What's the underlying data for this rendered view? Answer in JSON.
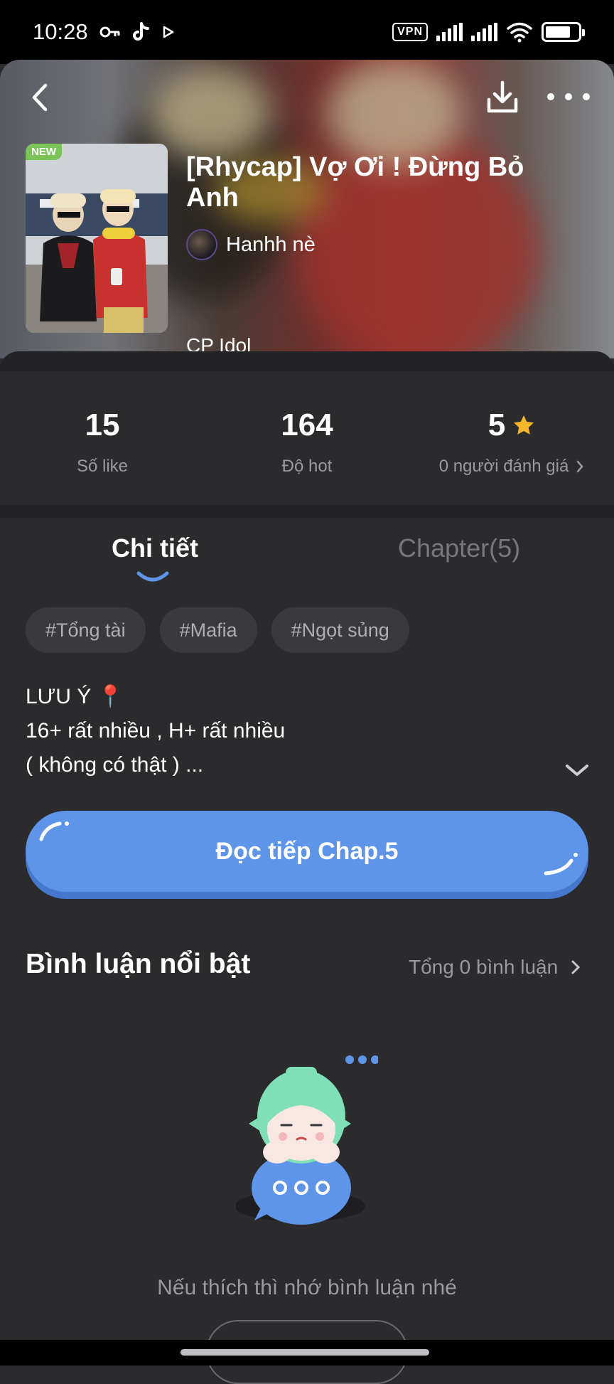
{
  "status_bar": {
    "time": "10:28",
    "vpn_label": "VPN",
    "battery_level": 0.78,
    "icons": [
      "key-icon",
      "tiktok-icon",
      "play-icon",
      "vpn-icon",
      "signal-icon",
      "signal-icon",
      "wifi-icon",
      "battery-icon"
    ]
  },
  "header": {
    "icons": [
      "back-arrow-icon",
      "download-icon",
      "more-icon"
    ]
  },
  "story": {
    "badge": "NEW",
    "title": "[Rhycap] Vợ Ơi ! Đừng Bỏ Anh",
    "author": "Hanhh nè",
    "category": "CP Idol"
  },
  "stats": {
    "likes_value": "15",
    "likes_label": "Số like",
    "hot_value": "164",
    "hot_label": "Độ hot",
    "rating_value": "5",
    "rating_label": "0 người đánh giá",
    "star_color": "#f5b62a"
  },
  "tabs": {
    "details": "Chi tiết",
    "chapters": "Chapter(5)",
    "active": "details"
  },
  "tags": [
    "#Tổng tài",
    "#Mafia",
    "#Ngọt sủng"
  ],
  "description": {
    "line1": "LƯU Ý 📍",
    "line2": "16+ rất nhiều , H+ rất nhiều",
    "line3": "( không có thật ) ..."
  },
  "read_button": {
    "label": "Đọc tiếp Chap.5",
    "color": "#5f95e8"
  },
  "comments": {
    "title": "Bình luận nổi bật",
    "total": "Tổng 0 bình luận",
    "empty_text": "Nếu thích thì nhớ bình luận nhé"
  }
}
